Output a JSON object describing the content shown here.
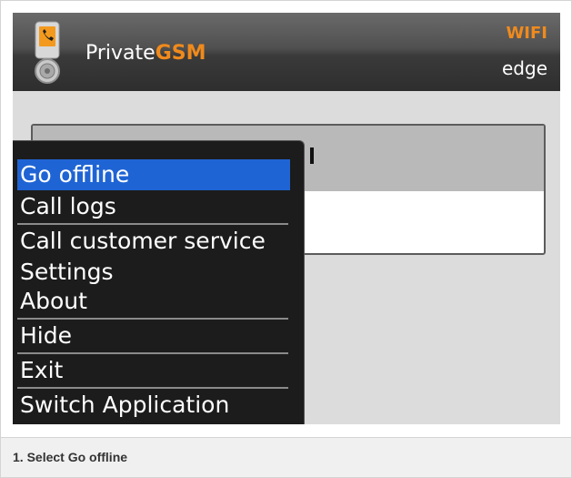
{
  "app": {
    "title_plain": "Private",
    "title_accent": "GSM",
    "icon": "phone-lock-icon"
  },
  "status": {
    "wifi": "WIFI",
    "network": "edge"
  },
  "menu": {
    "items": [
      {
        "label": "Go offline",
        "selected": true
      },
      {
        "label": "Call logs",
        "selected": false
      },
      {
        "label": "Call customer service",
        "selected": false
      },
      {
        "label": "Settings",
        "selected": false
      },
      {
        "label": "About",
        "selected": false
      },
      {
        "label": "Hide",
        "selected": false
      },
      {
        "label": "Exit",
        "selected": false
      },
      {
        "label": "Switch Application",
        "selected": false
      }
    ]
  },
  "caption": {
    "text": "1. Select Go offline"
  },
  "colors": {
    "accent": "#f08a1c",
    "selection": "#1f64d4",
    "menu_background": "#1c1c1c",
    "header_background": "#3a3a3a"
  }
}
